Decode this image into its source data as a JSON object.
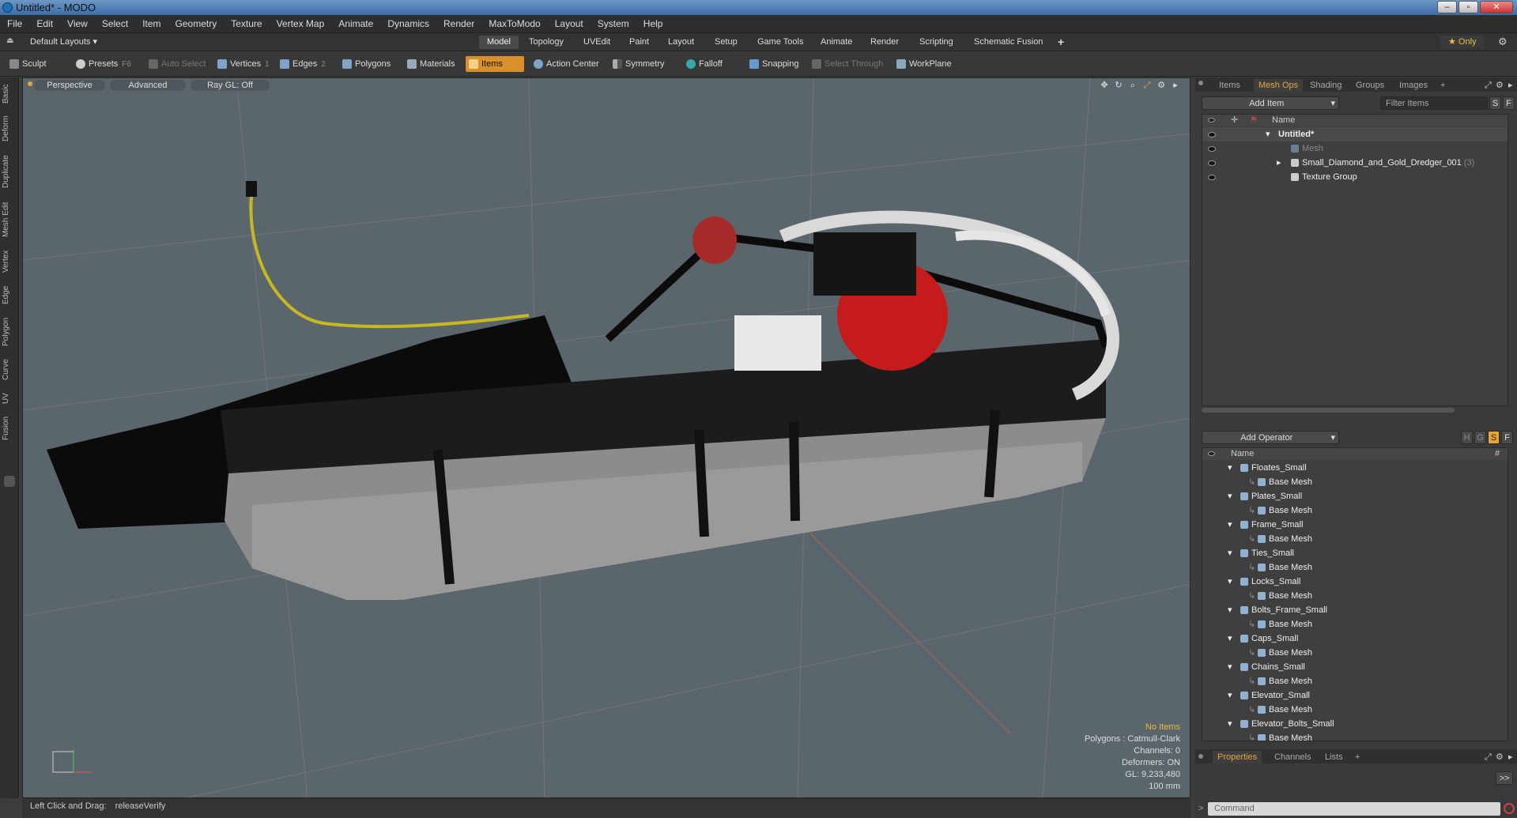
{
  "window": {
    "title": "Untitled* - MODO"
  },
  "menu": [
    "File",
    "Edit",
    "View",
    "Select",
    "Item",
    "Geometry",
    "Texture",
    "Vertex Map",
    "Animate",
    "Dynamics",
    "Render",
    "MaxToModo",
    "Layout",
    "System",
    "Help"
  ],
  "layoutbar": {
    "layout_selector": "Default Layouts ▾",
    "tabs": [
      "Model",
      "Topology",
      "UVEdit",
      "Paint",
      "Layout",
      "Setup",
      "Game Tools",
      "Animate",
      "Render",
      "Scripting",
      "Schematic Fusion"
    ],
    "active_tab": "Model",
    "add": "+",
    "only_label": "★ Only"
  },
  "toolbar": {
    "sculpt": "Sculpt",
    "presets": "Presets",
    "presets_key": "F6",
    "auto_select": "Auto Select",
    "vertices": "Vertices",
    "vertices_key": "1",
    "edges": "Edges",
    "edges_key": "2",
    "polygons": "Polygons",
    "materials": "Materials",
    "items": "Items",
    "action_center": "Action Center",
    "symmetry": "Symmetry",
    "falloff": "Falloff",
    "snapping": "Snapping",
    "select_through": "Select Through",
    "workplane": "WorkPlane"
  },
  "left_tabs": [
    "Basic",
    "Deform",
    "Duplicate",
    "Mesh Edit",
    "Vertex",
    "Edge",
    "Polygon",
    "Curve",
    "UV",
    "Fusion"
  ],
  "viewport": {
    "perspective": "Perspective",
    "advanced": "Advanced",
    "raygl": "Ray GL: Off",
    "info": {
      "no_items": "No Items",
      "polygons": "Polygons : Catmull-Clark",
      "channels": "Channels: 0",
      "deformers": "Deformers: ON",
      "gl": "GL: 9,233,480",
      "scale": "100 mm"
    }
  },
  "status": {
    "hint": "Left Click and Drag:",
    "action": "releaseVerify"
  },
  "items_panel": {
    "tabs": [
      "Items",
      "Mesh Ops",
      "Shading",
      "Groups",
      "Images"
    ],
    "active_tab": "Mesh Ops",
    "add_item": "Add Item",
    "filter": "Filter Items",
    "s_btn": "S",
    "f_btn": "F",
    "name_header": "Name",
    "tree": [
      {
        "label": "Untitled*",
        "indent": 0,
        "bold": true,
        "dim": false,
        "count": ""
      },
      {
        "label": "Mesh",
        "indent": 1,
        "bold": false,
        "dim": true,
        "count": ""
      },
      {
        "label": "Small_Diamond_and_Gold_Dredger_001",
        "indent": 1,
        "bold": false,
        "dim": false,
        "count": "(3)"
      },
      {
        "label": "Texture Group",
        "indent": 1,
        "bold": false,
        "dim": false,
        "count": ""
      }
    ]
  },
  "meshops_panel": {
    "add_operator": "Add Operator",
    "buttons": [
      "H",
      "G",
      "S",
      "F"
    ],
    "name_header": "Name",
    "hash_header": "#",
    "groups": [
      "Floates_Small",
      "Plates_Small",
      "Frame_Small",
      "Ties_Small",
      "Locks_Small",
      "Bolts_Frame_Small",
      "Caps_Small",
      "Chains_Small",
      "Elevator_Small",
      "Elevator_Bolts_Small"
    ],
    "child": "Base Mesh"
  },
  "props_panel": {
    "tabs": [
      "Properties",
      "Channels",
      "Lists"
    ],
    "active_tab": "Properties",
    "expand": ">>",
    "command_placeholder": "Command"
  },
  "colors": {
    "accent": "#e7a53a",
    "viewport_bg": "#5b666c",
    "items_on": "#d9902a"
  }
}
